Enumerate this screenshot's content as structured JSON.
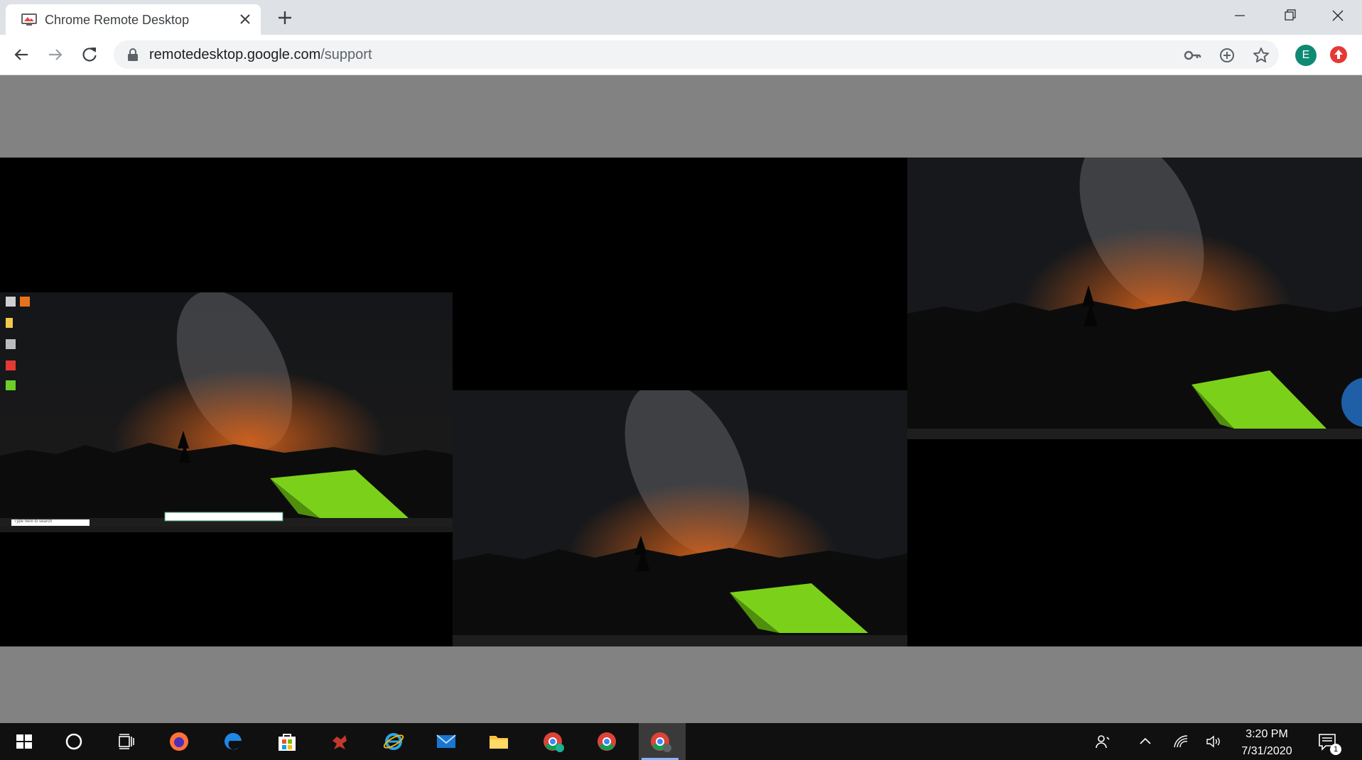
{
  "browser": {
    "tab": {
      "title": "Chrome Remote Desktop"
    },
    "address": {
      "host": "remotedesktop.google.com",
      "path": "/support"
    },
    "profile_initial": "E"
  },
  "remote_session": {
    "monitors": [
      {
        "name": "left-monitor",
        "search_placeholder": "Type here to search"
      },
      {
        "name": "middle-monitor"
      },
      {
        "name": "right-monitor"
      }
    ]
  },
  "taskbar": {
    "apps": [
      "start",
      "cortana",
      "task-view",
      "firefox",
      "edge",
      "store",
      "app",
      "internet-explorer",
      "mail",
      "file-explorer",
      "chrome-k",
      "chrome",
      "chrome-remote"
    ],
    "time": "3:20 PM",
    "date": "7/31/2020",
    "notification_count": "1"
  },
  "colors": {
    "accent": "#1a73e8",
    "profile": "#0e8a74",
    "tent": "#7bd11a"
  }
}
